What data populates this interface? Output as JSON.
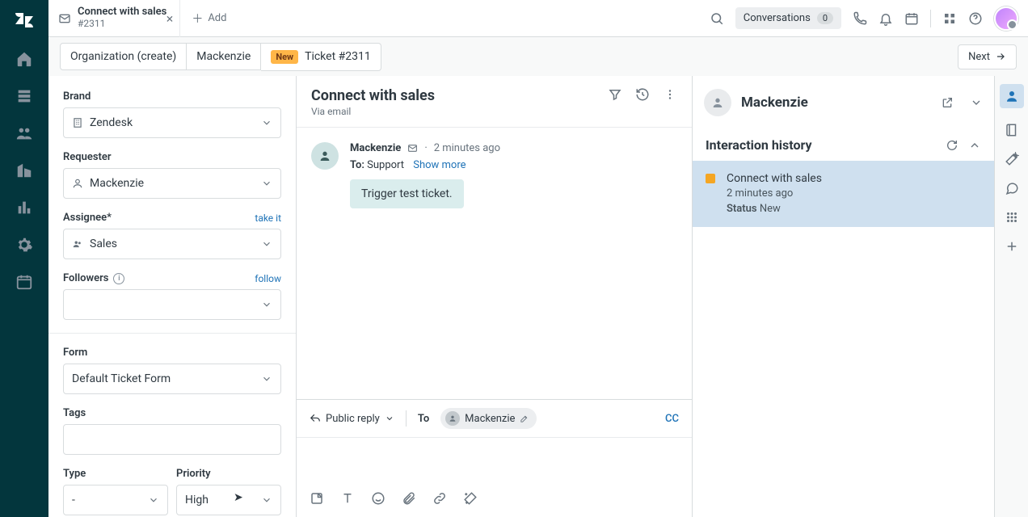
{
  "tab": {
    "title": "Connect with sales",
    "sub": "#2311"
  },
  "addtab": "Add",
  "topbar": {
    "conversations": "Conversations",
    "conv_count": "0"
  },
  "breadcrumb": {
    "org": "Organization (create)",
    "user": "Mackenzie",
    "new": "New",
    "ticket": "Ticket #2311"
  },
  "next": "Next",
  "fields": {
    "brand_label": "Brand",
    "brand_value": "Zendesk",
    "requester_label": "Requester",
    "requester_value": "Mackenzie",
    "assignee_label": "Assignee*",
    "assignee_action": "take it",
    "assignee_value": "Sales",
    "followers_label": "Followers",
    "followers_action": "follow",
    "form_label": "Form",
    "form_value": "Default Ticket Form",
    "tags_label": "Tags",
    "type_label": "Type",
    "type_value": "-",
    "priority_label": "Priority",
    "priority_value": "High"
  },
  "ticket": {
    "title": "Connect with sales",
    "via": "Via email",
    "msg_name": "Mackenzie",
    "msg_time": "2 minutes ago",
    "to_label": "To:",
    "to_value": "Support",
    "show_more": "Show more",
    "body": "Trigger test ticket."
  },
  "composer": {
    "reply": "Public reply",
    "to_label": "To",
    "to_name": "Mackenzie",
    "cc": "CC"
  },
  "right": {
    "user": "Mackenzie",
    "section": "Interaction history",
    "item_title": "Connect with sales",
    "item_time": "2 minutes ago",
    "item_status_lbl": "Status",
    "item_status_val": "New"
  }
}
